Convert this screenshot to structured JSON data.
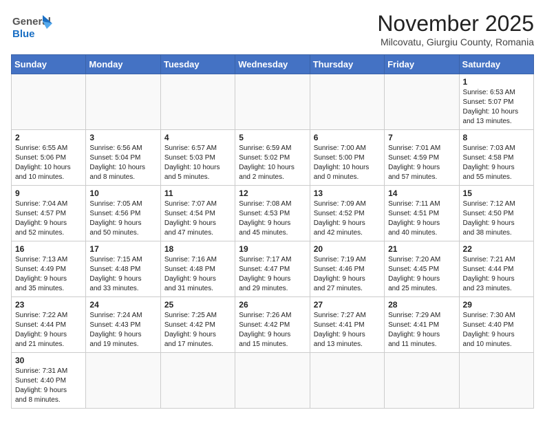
{
  "header": {
    "logo_general": "General",
    "logo_blue": "Blue",
    "title": "November 2025",
    "subtitle": "Milcovatu, Giurgiu County, Romania"
  },
  "days_of_week": [
    "Sunday",
    "Monday",
    "Tuesday",
    "Wednesday",
    "Thursday",
    "Friday",
    "Saturday"
  ],
  "weeks": [
    [
      {
        "day": "",
        "info": ""
      },
      {
        "day": "",
        "info": ""
      },
      {
        "day": "",
        "info": ""
      },
      {
        "day": "",
        "info": ""
      },
      {
        "day": "",
        "info": ""
      },
      {
        "day": "",
        "info": ""
      },
      {
        "day": "1",
        "info": "Sunrise: 6:53 AM\nSunset: 5:07 PM\nDaylight: 10 hours\nand 13 minutes."
      }
    ],
    [
      {
        "day": "2",
        "info": "Sunrise: 6:55 AM\nSunset: 5:06 PM\nDaylight: 10 hours\nand 10 minutes."
      },
      {
        "day": "3",
        "info": "Sunrise: 6:56 AM\nSunset: 5:04 PM\nDaylight: 10 hours\nand 8 minutes."
      },
      {
        "day": "4",
        "info": "Sunrise: 6:57 AM\nSunset: 5:03 PM\nDaylight: 10 hours\nand 5 minutes."
      },
      {
        "day": "5",
        "info": "Sunrise: 6:59 AM\nSunset: 5:02 PM\nDaylight: 10 hours\nand 2 minutes."
      },
      {
        "day": "6",
        "info": "Sunrise: 7:00 AM\nSunset: 5:00 PM\nDaylight: 10 hours\nand 0 minutes."
      },
      {
        "day": "7",
        "info": "Sunrise: 7:01 AM\nSunset: 4:59 PM\nDaylight: 9 hours\nand 57 minutes."
      },
      {
        "day": "8",
        "info": "Sunrise: 7:03 AM\nSunset: 4:58 PM\nDaylight: 9 hours\nand 55 minutes."
      }
    ],
    [
      {
        "day": "9",
        "info": "Sunrise: 7:04 AM\nSunset: 4:57 PM\nDaylight: 9 hours\nand 52 minutes."
      },
      {
        "day": "10",
        "info": "Sunrise: 7:05 AM\nSunset: 4:56 PM\nDaylight: 9 hours\nand 50 minutes."
      },
      {
        "day": "11",
        "info": "Sunrise: 7:07 AM\nSunset: 4:54 PM\nDaylight: 9 hours\nand 47 minutes."
      },
      {
        "day": "12",
        "info": "Sunrise: 7:08 AM\nSunset: 4:53 PM\nDaylight: 9 hours\nand 45 minutes."
      },
      {
        "day": "13",
        "info": "Sunrise: 7:09 AM\nSunset: 4:52 PM\nDaylight: 9 hours\nand 42 minutes."
      },
      {
        "day": "14",
        "info": "Sunrise: 7:11 AM\nSunset: 4:51 PM\nDaylight: 9 hours\nand 40 minutes."
      },
      {
        "day": "15",
        "info": "Sunrise: 7:12 AM\nSunset: 4:50 PM\nDaylight: 9 hours\nand 38 minutes."
      }
    ],
    [
      {
        "day": "16",
        "info": "Sunrise: 7:13 AM\nSunset: 4:49 PM\nDaylight: 9 hours\nand 35 minutes."
      },
      {
        "day": "17",
        "info": "Sunrise: 7:15 AM\nSunset: 4:48 PM\nDaylight: 9 hours\nand 33 minutes."
      },
      {
        "day": "18",
        "info": "Sunrise: 7:16 AM\nSunset: 4:48 PM\nDaylight: 9 hours\nand 31 minutes."
      },
      {
        "day": "19",
        "info": "Sunrise: 7:17 AM\nSunset: 4:47 PM\nDaylight: 9 hours\nand 29 minutes."
      },
      {
        "day": "20",
        "info": "Sunrise: 7:19 AM\nSunset: 4:46 PM\nDaylight: 9 hours\nand 27 minutes."
      },
      {
        "day": "21",
        "info": "Sunrise: 7:20 AM\nSunset: 4:45 PM\nDaylight: 9 hours\nand 25 minutes."
      },
      {
        "day": "22",
        "info": "Sunrise: 7:21 AM\nSunset: 4:44 PM\nDaylight: 9 hours\nand 23 minutes."
      }
    ],
    [
      {
        "day": "23",
        "info": "Sunrise: 7:22 AM\nSunset: 4:44 PM\nDaylight: 9 hours\nand 21 minutes."
      },
      {
        "day": "24",
        "info": "Sunrise: 7:24 AM\nSunset: 4:43 PM\nDaylight: 9 hours\nand 19 minutes."
      },
      {
        "day": "25",
        "info": "Sunrise: 7:25 AM\nSunset: 4:42 PM\nDaylight: 9 hours\nand 17 minutes."
      },
      {
        "day": "26",
        "info": "Sunrise: 7:26 AM\nSunset: 4:42 PM\nDaylight: 9 hours\nand 15 minutes."
      },
      {
        "day": "27",
        "info": "Sunrise: 7:27 AM\nSunset: 4:41 PM\nDaylight: 9 hours\nand 13 minutes."
      },
      {
        "day": "28",
        "info": "Sunrise: 7:29 AM\nSunset: 4:41 PM\nDaylight: 9 hours\nand 11 minutes."
      },
      {
        "day": "29",
        "info": "Sunrise: 7:30 AM\nSunset: 4:40 PM\nDaylight: 9 hours\nand 10 minutes."
      }
    ],
    [
      {
        "day": "30",
        "info": "Sunrise: 7:31 AM\nSunset: 4:40 PM\nDaylight: 9 hours\nand 8 minutes."
      },
      {
        "day": "",
        "info": ""
      },
      {
        "day": "",
        "info": ""
      },
      {
        "day": "",
        "info": ""
      },
      {
        "day": "",
        "info": ""
      },
      {
        "day": "",
        "info": ""
      },
      {
        "day": "",
        "info": ""
      }
    ]
  ]
}
